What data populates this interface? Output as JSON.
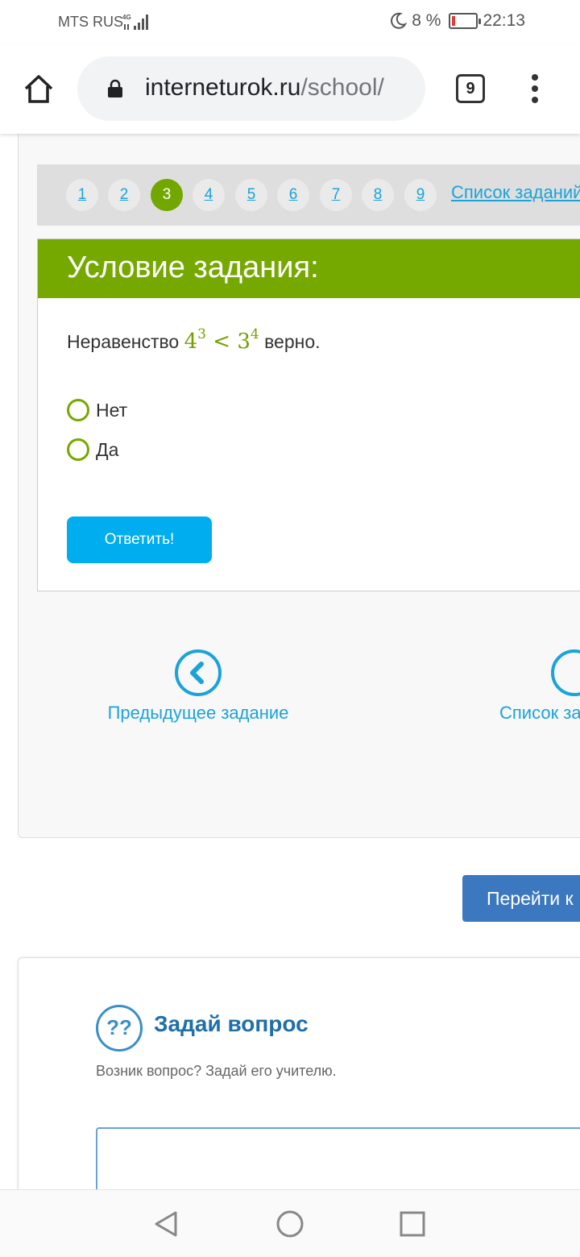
{
  "status_bar": {
    "carrier": "MTS RUS",
    "network": "4G",
    "battery": "8 %",
    "battery_level_percent": 8,
    "time": "22:13"
  },
  "browser": {
    "url_domain": "interneturok.ru",
    "url_path": "/school/",
    "tab_count": "9"
  },
  "pager": {
    "pages": [
      "1",
      "2",
      "3",
      "4",
      "5",
      "6",
      "7",
      "8",
      "9"
    ],
    "active": "3",
    "list_link": "Список заданий"
  },
  "task": {
    "title": "Условие задания:",
    "question_prefix": "Неравенство",
    "math": {
      "base1": "4",
      "exp1": "3",
      "op": "<",
      "base2": "3",
      "exp2": "4"
    },
    "question_suffix": "верно.",
    "options": [
      "Нет",
      "Да"
    ],
    "answer_button": "Ответить!"
  },
  "navigation": {
    "prev_label": "Предыдущее задание",
    "next_label": "Список заданий"
  },
  "goto_button": "Перейти к",
  "ask": {
    "icon_text": "??",
    "title": "Задай вопрос",
    "subtitle": "Возник вопрос? Задай его учителю."
  },
  "colors": {
    "accent_green": "#76a900",
    "link_blue": "#1aa3d9",
    "button_cyan": "#00adee",
    "button_blue": "#3c78bf"
  }
}
